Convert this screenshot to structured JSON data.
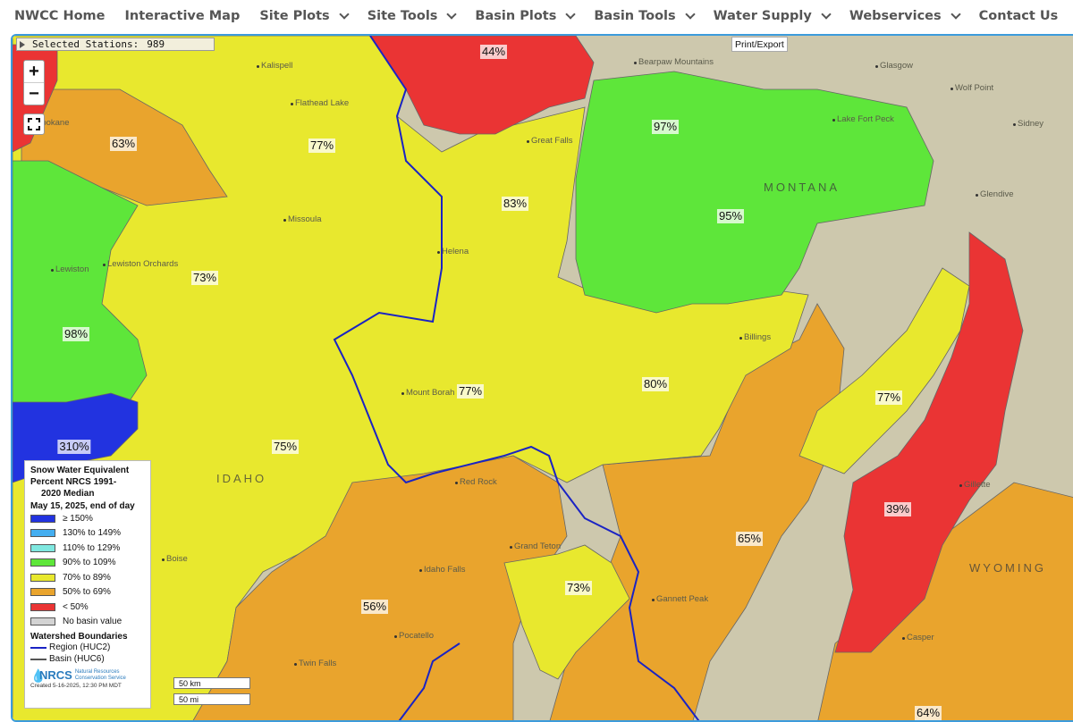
{
  "nav": {
    "items": [
      {
        "label": "NWCC Home",
        "dropdown": false
      },
      {
        "label": "Interactive Map",
        "dropdown": false
      },
      {
        "label": "Site Plots",
        "dropdown": true
      },
      {
        "label": "Site Tools",
        "dropdown": true
      },
      {
        "label": "Basin Plots",
        "dropdown": true
      },
      {
        "label": "Basin Tools",
        "dropdown": true
      },
      {
        "label": "Water Supply",
        "dropdown": true
      },
      {
        "label": "Webservices",
        "dropdown": true
      },
      {
        "label": "Contact Us",
        "dropdown": false
      }
    ]
  },
  "map": {
    "selected_label": "Selected Stations:",
    "selected_count": "989",
    "print_label": "Print/Export",
    "zoom_in": "+",
    "zoom_out": "−",
    "basin_values": [
      "44%",
      "63%",
      "77%",
      "83%",
      "97%",
      "95%",
      "73%",
      "98%",
      "77%",
      "80%",
      "77%",
      "310%",
      "75%",
      "39%",
      "65%",
      "73%",
      "56%",
      "64%"
    ],
    "places": [
      "Kalispell",
      "Flathead Lake",
      "Spokane",
      "Missoula",
      "Lewiston",
      "Lewiston Orchards",
      "Helena",
      "Great Falls",
      "Glasgow",
      "Wolf Point",
      "Sidney",
      "Glendive",
      "Lake Fort Peck",
      "Billings",
      "Gillette",
      "Casper",
      "Boise",
      "Idaho Falls",
      "Pocatello",
      "Twin Falls",
      "Grand Teton",
      "Gannett Peak",
      "Mount Borah",
      "Red Rock",
      "Bearpaw Mountains"
    ],
    "regions": [
      "MONTANA",
      "WYOMING",
      "IDAHO"
    ],
    "scale": [
      "50 km",
      "50 mi"
    ]
  },
  "legend": {
    "title_lines": [
      "Snow Water Equivalent",
      "Percent NRCS 1991-",
      "2020 Median"
    ],
    "date": "May 15, 2025, end of day",
    "items": [
      {
        "label": "≥ 150%",
        "color": "#2233e0"
      },
      {
        "label": "130% to 149%",
        "color": "#44aef0"
      },
      {
        "label": "110% to 129%",
        "color": "#7fe8e0"
      },
      {
        "label": "90% to 109%",
        "color": "#5ee63a"
      },
      {
        "label": "70% to 89%",
        "color": "#e8e82e"
      },
      {
        "label": "50% to 69%",
        "color": "#e9a42d"
      },
      {
        "label": "< 50%",
        "color": "#ea3434"
      },
      {
        "label": "No basin value",
        "color": "#d3d3d3"
      }
    ],
    "boundaries_title": "Watershed Boundaries",
    "boundaries": [
      {
        "label": "Region (HUC2)",
        "color": "#1a23c4"
      },
      {
        "label": "Basin (HUC6)",
        "color": "#555555"
      }
    ],
    "agency": "NRCS",
    "agency_full_lines": [
      "Natural Resources",
      "Conservation Service"
    ],
    "created": "Created 5-16-2025, 12:30 PM MDT"
  }
}
